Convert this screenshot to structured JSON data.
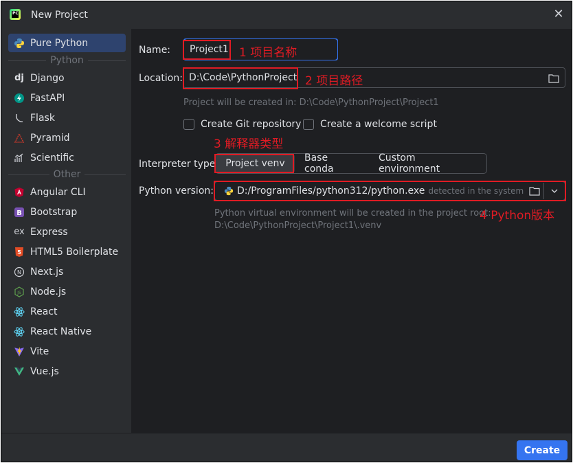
{
  "window": {
    "title": "New Project"
  },
  "sidebar": {
    "selected": {
      "label": "Pure Python"
    },
    "group_python": "Python",
    "python_items": [
      {
        "label": "Django",
        "icon": "django-icon"
      },
      {
        "label": "FastAPI",
        "icon": "fastapi-icon"
      },
      {
        "label": "Flask",
        "icon": "flask-icon"
      },
      {
        "label": "Pyramid",
        "icon": "pyramid-icon"
      },
      {
        "label": "Scientific",
        "icon": "scientific-icon"
      }
    ],
    "group_other": "Other",
    "other_items": [
      {
        "label": "Angular CLI",
        "icon": "angular-icon"
      },
      {
        "label": "Bootstrap",
        "icon": "bootstrap-icon"
      },
      {
        "label": "Express",
        "icon": "express-icon"
      },
      {
        "label": "HTML5 Boilerplate",
        "icon": "html5-icon"
      },
      {
        "label": "Next.js",
        "icon": "nextjs-icon"
      },
      {
        "label": "Node.js",
        "icon": "nodejs-icon"
      },
      {
        "label": "React",
        "icon": "react-icon"
      },
      {
        "label": "React Native",
        "icon": "react-native-icon"
      },
      {
        "label": "Vite",
        "icon": "vite-icon"
      },
      {
        "label": "Vue.js",
        "icon": "vuejs-icon"
      }
    ]
  },
  "form": {
    "name_label": "Name:",
    "name_value": "Project1",
    "location_label": "Location:",
    "location_value": "D:\\Code\\PythonProject",
    "created_in_hint": "Project will be created in: D:\\Code\\PythonProject\\Project1",
    "create_git_label": "Create Git repository",
    "welcome_script_label": "Create a welcome script",
    "interpreter_label": "Interpreter type:",
    "interpreter_options": [
      "Project venv",
      "Base conda",
      "Custom environment"
    ],
    "python_version_label": "Python version:",
    "python_version_value": "D:/ProgramFiles/python312/python.exe",
    "python_version_detected": "detected in the system",
    "venv_hint_line1": "Python virtual environment will be created in the project root:",
    "venv_hint_line2": "D:\\Code\\PythonProject\\Project1\\.venv"
  },
  "annotations": {
    "a1": "1 项目名称",
    "a2": "2 项目路径",
    "a3": "3 解释器类型",
    "a4": "4 Python版本"
  },
  "footer": {
    "create_label": "Create"
  },
  "colors": {
    "accent": "#3574f0",
    "annotation": "#e01b24",
    "selection": "#2e436e"
  }
}
